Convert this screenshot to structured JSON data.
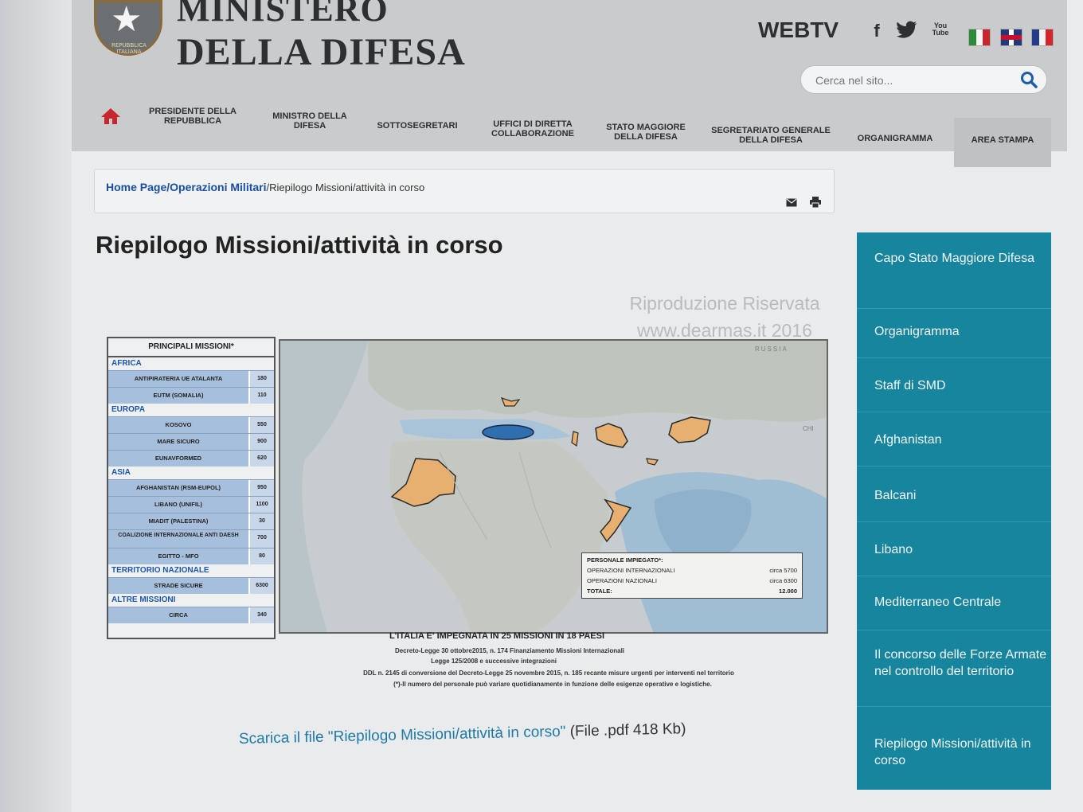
{
  "header": {
    "title_line1": "MINISTERO",
    "title_line2": "DELLA DIFESA",
    "emblem_text": "REPUBBLICA ITALIANA",
    "webtv_label": "WEBTV",
    "social": [
      "f",
      "t",
      "You Tube"
    ],
    "flags": [
      "italian-flag",
      "uk-flag",
      "french-flag"
    ],
    "search_placeholder": "Cerca nel sito..."
  },
  "nav": {
    "items": [
      {
        "label": "PRESIDENTE DELLA REPUBBLICA"
      },
      {
        "label": "MINISTRO DELLA DIFESA"
      },
      {
        "label": "SOTTOSEGRETARI"
      },
      {
        "label": "UFFICI DI DIRETTA COLLABORAZIONE"
      },
      {
        "label": "STATO MAGGIORE DELLA DIFESA"
      },
      {
        "label": "SEGRETARIATO GENERALE DELLA DIFESA"
      },
      {
        "label": "ORGANIGRAMMA"
      }
    ],
    "stampa": "AREA STAMPA"
  },
  "breadcrumb": {
    "home": "Home Page",
    "section": "Operazioni Militari",
    "current": "Riepilogo Missioni/attività in corso"
  },
  "page_title": "Riepilogo Missioni/attività in corso",
  "watermark": {
    "line1": "Riproduzione Riservata",
    "line2": "www.dearmas.it 2016"
  },
  "figure": {
    "legend_title": "PRINCIPALI MISSIONI*",
    "regions": [
      {
        "name": "AFRICA",
        "rows": [
          {
            "name": "ANTIPIRATERIA UE ATALANTA",
            "value": "180"
          },
          {
            "name": "EUTM (SOMALIA)",
            "value": "110"
          }
        ]
      },
      {
        "name": "EUROPA",
        "rows": [
          {
            "name": "KOSOVO",
            "value": "550"
          },
          {
            "name": "MARE SICURO",
            "value": "900"
          },
          {
            "name": "EUNAVFORMED",
            "value": "620"
          }
        ]
      },
      {
        "name": "ASIA",
        "rows": [
          {
            "name": "AFGHANISTAN (RSM-EUPOL)",
            "value": "950"
          },
          {
            "name": "LIBANO (UNIFIL)",
            "value": "1100"
          },
          {
            "name": "MIADIT (PALESTINA)",
            "value": "30"
          },
          {
            "name": "COALIZIONE INTERNAZIONALE ANTI DAESH",
            "value": "700"
          },
          {
            "name": "EGITTO - MFO",
            "value": "80"
          }
        ]
      },
      {
        "name": "TERRITORIO NAZIONALE",
        "rows": [
          {
            "name": "STRADE SICURE",
            "value": "6300"
          }
        ]
      },
      {
        "name": "ALTRE MISSIONI",
        "rows": [
          {
            "name": "CIRCA",
            "value": "340"
          }
        ]
      }
    ],
    "map_labels": {
      "russia": "RUSSIA",
      "china": "CHI"
    },
    "personnel_box": {
      "header": "PERSONALE IMPIEGATO*:",
      "rows": [
        {
          "label": "OPERAZIONI INTERNAZIONALI",
          "value": "circa 5700"
        },
        {
          "label": "OPERAZIONI NAZIONALI",
          "value": "circa 6300"
        },
        {
          "label": "TOTALE:",
          "value": "12.000"
        }
      ]
    },
    "caption_title": "L'ITALIA E' IMPEGNATA IN 25 MISSIONI IN 18 PAESI",
    "caption_lines": [
      "Decreto-Legge 30 ottobre2015, n. 174 Finanziamento Missioni Internazionali",
      "Legge 125/2008 e successive integrazioni",
      "DDL n. 2145 di conversione del Decreto-Legge 25 novembre 2015, n. 185 recante misure urgenti per interventi nel territorio",
      "(*)-Il numero del personale può variare quotidianamente in funzione delle esigenze operative e logistiche."
    ]
  },
  "download": {
    "prefix": "Scarica il file ",
    "link": "\"Riepilogo Missioni/attività in corso\"",
    "size": " (File .pdf 418 Kb)"
  },
  "sidebar": {
    "items": [
      {
        "label": "Capo Stato Maggiore Difesa"
      },
      {
        "label": "Organigramma"
      },
      {
        "label": "Staff di SMD"
      },
      {
        "label": "Afghanistan"
      },
      {
        "label": "Balcani"
      },
      {
        "label": "Libano"
      },
      {
        "label": "Mediterraneo Centrale"
      },
      {
        "label": "Il concorso delle Forze Armate nel controllo del territorio"
      },
      {
        "label": "Riepilogo Missioni/attività in corso"
      }
    ]
  },
  "colors": {
    "sidebar_bg": "#17859d",
    "link_blue": "#1a4fa0",
    "download_link": "#1f7aa8",
    "mission_fill": "#e8b070",
    "header_bg": "#c9cbcd"
  }
}
